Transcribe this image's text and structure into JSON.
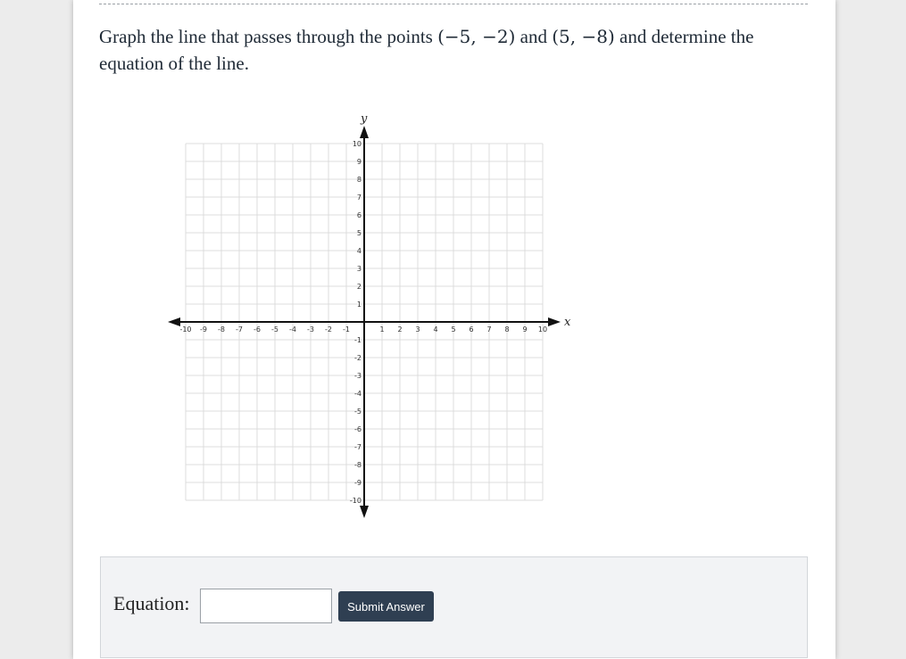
{
  "question": {
    "text_before": "Graph the line that passes through the points",
    "point1": "(−5, −2)",
    "text_and": "and",
    "point2": "(5, −8)",
    "text_after": "and determine the equation of the line."
  },
  "graph": {
    "x_axis_label": "x",
    "y_axis_label": "y",
    "x_min": -10,
    "x_max": 10,
    "y_min": -10,
    "y_max": 10,
    "x_ticks": [
      "-10",
      "-9",
      "-8",
      "-7",
      "-6",
      "-5",
      "-4",
      "-3",
      "-2",
      "-1",
      "1",
      "2",
      "3",
      "4",
      "5",
      "6",
      "7",
      "8",
      "9",
      "10"
    ],
    "y_ticks_pos": [
      "10",
      "9",
      "8",
      "7",
      "6",
      "5",
      "4",
      "3",
      "2",
      "1"
    ],
    "y_ticks_neg": [
      "-1",
      "-2",
      "-3",
      "-4",
      "-5",
      "-6",
      "-7",
      "-8",
      "-9",
      "-10"
    ],
    "grid_color": "#dcdcdc",
    "axis_color": "#111111"
  },
  "answer": {
    "equation_label": "Equation:",
    "equation_value": "",
    "submit_label": "Submit Answer"
  }
}
